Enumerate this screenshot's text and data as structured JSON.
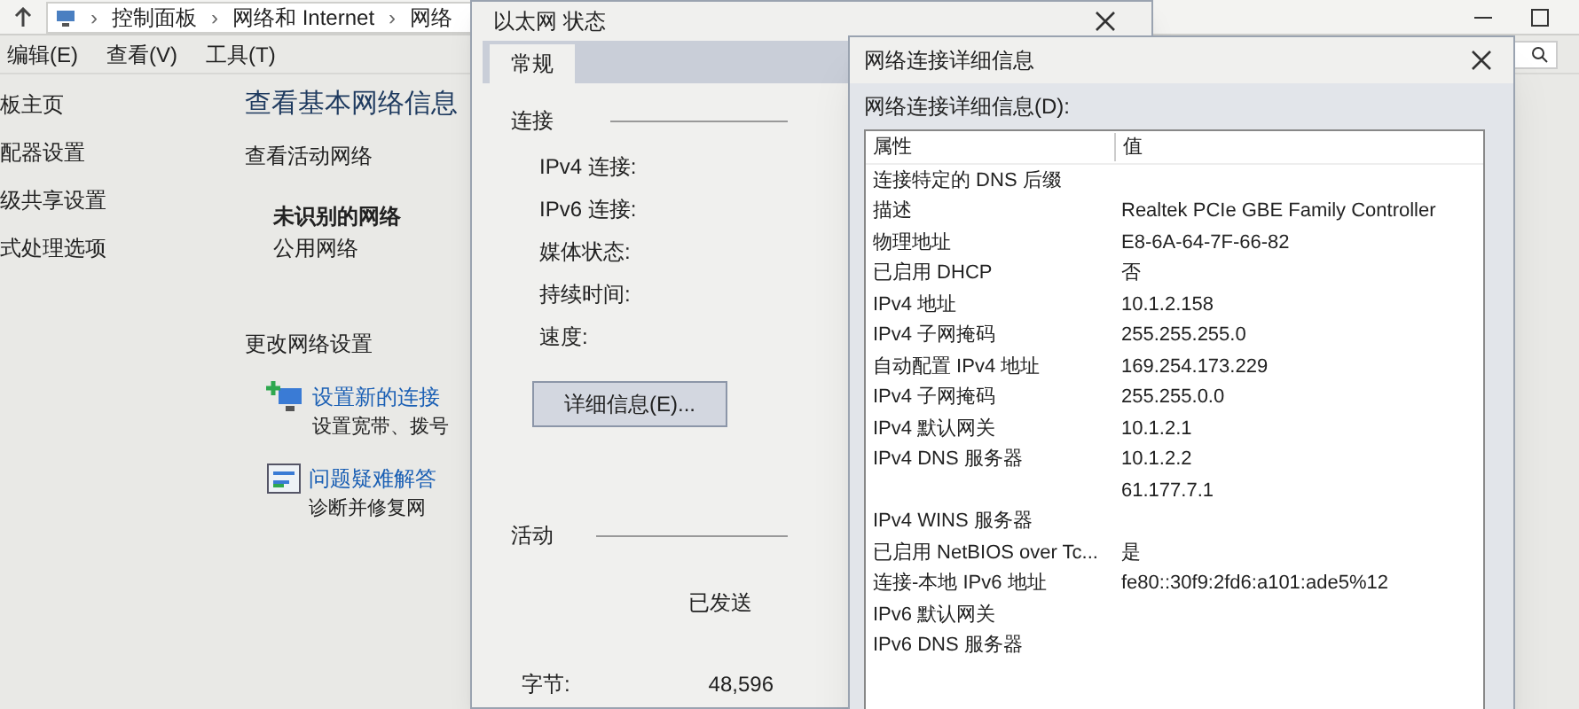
{
  "main_window": {
    "breadcrumb": [
      {
        "separator": "›",
        "label": "控制面板"
      },
      {
        "separator": "›",
        "label": "网络和 Internet"
      },
      {
        "separator": "›",
        "label": "网络"
      }
    ],
    "menu": [
      "编辑(E)",
      "查看(V)",
      "工具(T)"
    ],
    "sidebar": [
      "板主页",
      "配器设置",
      "级共享设置",
      "式处理选项"
    ],
    "heading": "查看基本网络信息",
    "active_network_section": "查看活动网络",
    "network_name": "未识别的网络",
    "network_type": "公用网络",
    "change_section": "更改网络设置",
    "tasks": [
      {
        "kind": "new-connection",
        "link": "设置新的连接",
        "description": "设置宽带、拨号"
      },
      {
        "kind": "troubleshoot",
        "link": "问题疑难解答",
        "description": "诊断并修复网"
      }
    ]
  },
  "status_dialog": {
    "title": "以太网 状态",
    "tabs": [
      {
        "label": "常规",
        "selected": true
      }
    ],
    "connection_section": "连接",
    "fields": [
      "IPv4 连接:",
      "IPv6 连接:",
      "媒体状态:",
      "持续时间:",
      "速度:"
    ],
    "details_button": "详细信息(E)...",
    "activity_section": "活动",
    "sent_label": "已发送",
    "bytes_label": "字节:",
    "bytes_sent": "48,596"
  },
  "details_dialog": {
    "title": "网络连接详细信息",
    "list_label": "网络连接详细信息(D):",
    "columns": [
      "属性",
      "值"
    ],
    "rows": [
      [
        "连接特定的 DNS 后缀",
        ""
      ],
      [
        "描述",
        "Realtek PCIe GBE Family Controller"
      ],
      [
        "物理地址",
        "E8-6A-64-7F-66-82"
      ],
      [
        "已启用 DHCP",
        "否"
      ],
      [
        "IPv4 地址",
        "10.1.2.158"
      ],
      [
        "IPv4 子网掩码",
        "255.255.255.0"
      ],
      [
        "自动配置 IPv4 地址",
        "169.254.173.229"
      ],
      [
        "IPv4 子网掩码",
        "255.255.0.0"
      ],
      [
        "IPv4 默认网关",
        "10.1.2.1"
      ],
      [
        "IPv4 DNS 服务器",
        "10.1.2.2"
      ],
      [
        "",
        "61.177.7.1"
      ],
      [
        "IPv4 WINS 服务器",
        ""
      ],
      [
        "已启用 NetBIOS over Tc...",
        "是"
      ],
      [
        "连接-本地 IPv6 地址",
        "fe80::30f9:2fd6:a101:ade5%12"
      ],
      [
        "IPv6 默认网关",
        ""
      ],
      [
        "IPv6 DNS 服务器",
        ""
      ]
    ]
  }
}
